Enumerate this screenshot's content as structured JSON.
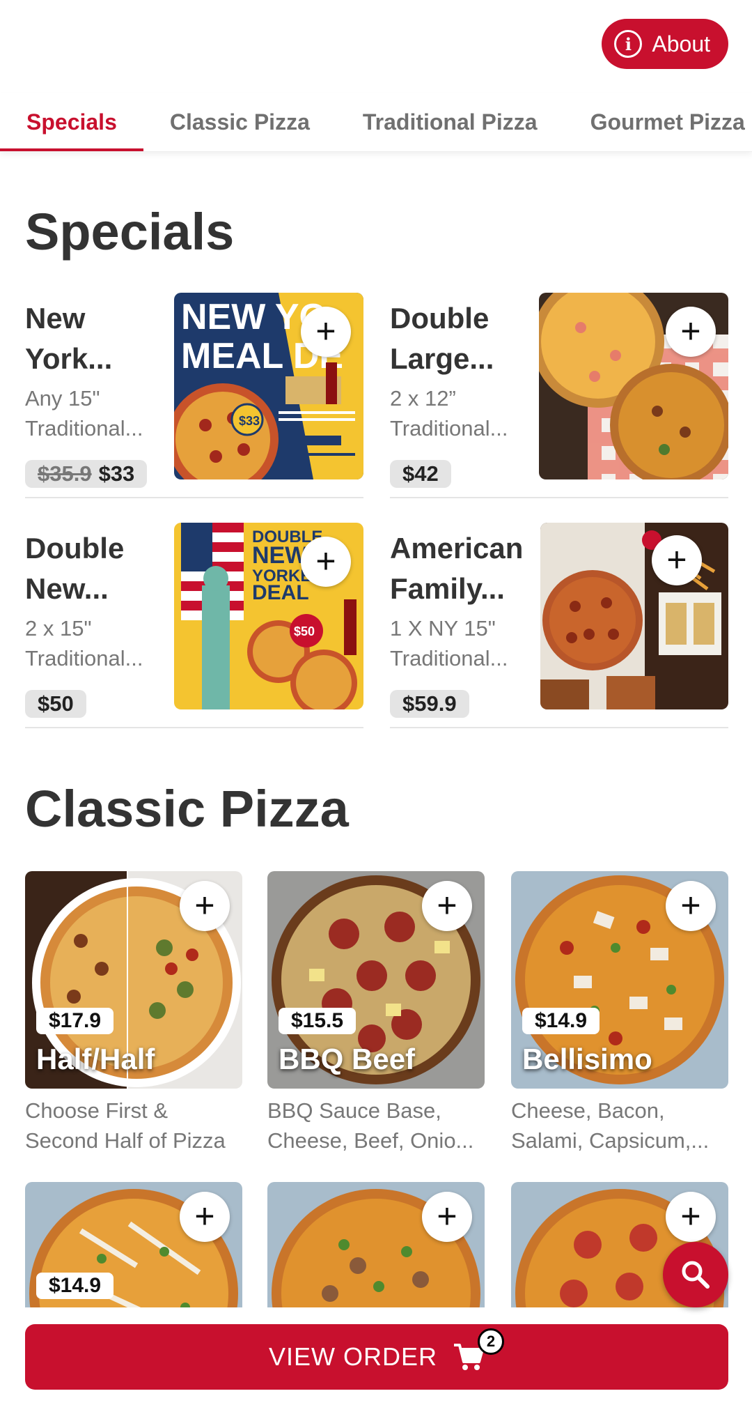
{
  "header": {
    "about_label": "About",
    "about_icon": "info-icon"
  },
  "tabs": [
    {
      "label": "Specials",
      "active": true
    },
    {
      "label": "Classic Pizza",
      "active": false
    },
    {
      "label": "Traditional Pizza",
      "active": false
    },
    {
      "label": "Gourmet Pizza",
      "active": false
    }
  ],
  "specials": {
    "title": "Specials",
    "items": [
      {
        "name": "New York...",
        "desc": "Any 15\" Traditional...",
        "old_price": "$35.9",
        "price": "$33"
      },
      {
        "name": "Double Large...",
        "desc": "2 x 12” Traditional...",
        "old_price": "",
        "price": "$42"
      },
      {
        "name": "Double New...",
        "desc": "2 x 15\" Traditional...",
        "old_price": "",
        "price": "$50"
      },
      {
        "name": "American Family...",
        "desc": "1 X NY 15\" Traditional...",
        "old_price": "",
        "price": "$59.9"
      }
    ],
    "promo_texts": {
      "ny_meal_deal": "NEW YORK MEAL DEAL",
      "ny_price_tag": "$33",
      "double_ny_deal": "DOUBLE NEW YORKER DEAL",
      "double_ny_price_tag": "$50"
    }
  },
  "classic": {
    "title": "Classic Pizza",
    "items": [
      {
        "name": "Half/Half",
        "price": "$17.9",
        "desc": "Choose First & Second Half of Pizza"
      },
      {
        "name": "BBQ Beef",
        "price": "$15.5",
        "desc": "BBQ Sauce Base, Cheese, Beef, Onio..."
      },
      {
        "name": "Bellisimo",
        "price": "$14.9",
        "desc": "Cheese, Bacon, Salami, Capsicum,..."
      },
      {
        "name": "",
        "price": "$14.9",
        "desc": ""
      },
      {
        "name": "",
        "price": "",
        "desc": ""
      },
      {
        "name": "",
        "price": "",
        "desc": ""
      }
    ]
  },
  "add_symbol": "+",
  "order": {
    "label": "VIEW ORDER",
    "count": "2",
    "icon": "cart-icon"
  },
  "search_icon": "search-icon",
  "colors": {
    "accent": "#c8102e",
    "text_dark": "#333333",
    "text_muted": "#777777"
  }
}
